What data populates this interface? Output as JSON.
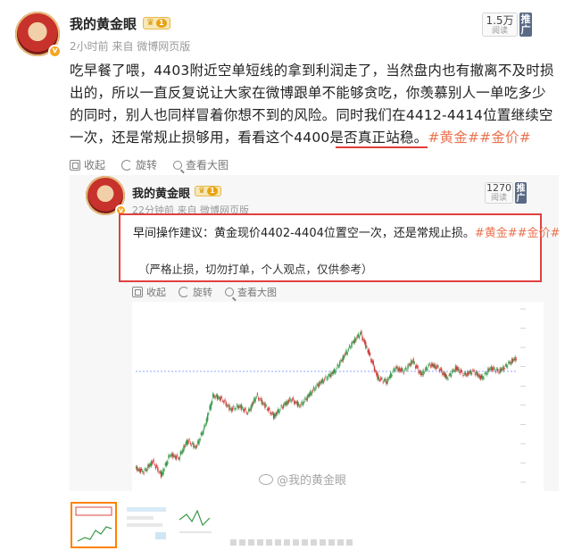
{
  "post": {
    "author": "我的黄金眼",
    "level": "1",
    "time_source": "2小时前  来自 微博网页版",
    "views_count": "1.5万",
    "views_label": "阅读",
    "promo_label": "推广",
    "text_a": "吃早餐了喂，4403附近空单短线的拿到利润走了，当然盘内也有撤离不及时损出的，所以一直反复说让大家在微博跟单不能够贪吃，你羡慕别人一单吃多少的同时，别人也同样冒着你想不到的风险。",
    "text_b": "同时我们在4412-4414位置继续空一次，还是常规止损够用，看看这个4400是否真正站稳。",
    "tags": "#黄金##金价#",
    "actions": {
      "collect": "收起",
      "rotate": "旋转",
      "view_large": "查看大图"
    }
  },
  "repost": {
    "author": "我的黄金眼",
    "level": "1",
    "time_source": "22分钟前  来自 微博网页版",
    "views_count": "1270",
    "views_label": "阅读",
    "promo_label": "推广",
    "suggestion": "早间操作建议：黄金现价4402-4404位置空一次，还是常规止损。",
    "tags": "#黄金##金价#",
    "disclaimer": "（严格止损，切勿打单，个人观点，仅供参考）",
    "actions": {
      "collect": "收起",
      "rotate": "旋转",
      "view_large": "查看大图"
    },
    "watermark": "@我的黄金眼"
  },
  "chart_data": {
    "type": "line",
    "title": "",
    "xlabel": "",
    "ylabel": "",
    "x": [
      0,
      10,
      20,
      30,
      40,
      50,
      60,
      70,
      80,
      90,
      100,
      110,
      120,
      130,
      140,
      150,
      160,
      170,
      180,
      190,
      200,
      210,
      220,
      230,
      240,
      250,
      260,
      270,
      280,
      290,
      300,
      310,
      320,
      330,
      340,
      350,
      360,
      370,
      380,
      390,
      400,
      410,
      420,
      430,
      440
    ],
    "values": [
      4374,
      4373,
      4376,
      4372,
      4378,
      4377,
      4382,
      4380,
      4386,
      4395,
      4394,
      4391,
      4392,
      4390,
      4395,
      4392,
      4389,
      4392,
      4394,
      4392,
      4395,
      4398,
      4400,
      4402,
      4406,
      4410,
      4413,
      4407,
      4400,
      4399,
      4403,
      4402,
      4405,
      4401,
      4404,
      4403,
      4400,
      4403,
      4401,
      4402,
      4400,
      4403,
      4402,
      4404,
      4406
    ],
    "ylim": [
      4370,
      4420
    ],
    "reference_level": 4402,
    "colors": {
      "up": "#3a9a4a",
      "down": "#d23a3a",
      "ref": "#8ea7ff"
    }
  }
}
